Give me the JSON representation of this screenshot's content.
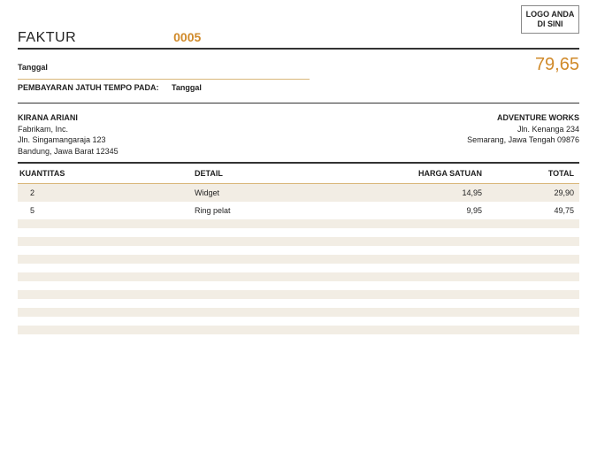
{
  "logo_text": "LOGO ANDA DI SINI",
  "header": {
    "label": "FAKTUR",
    "invoice_number": "0005"
  },
  "date_label": "Tanggal",
  "total_display": "79,65",
  "due": {
    "label": "PEMBAYARAN JATUH TEMPO PADA:",
    "value": "Tanggal"
  },
  "from": {
    "name": "KIRANA ARIANI",
    "company": "Fabrikam, Inc.",
    "street": "Jln. Singamangaraja 123",
    "city": "Bandung, Jawa Barat 12345"
  },
  "to": {
    "name": "ADVENTURE WORKS",
    "street": "Jln. Kenanga 234",
    "city": "Semarang, Jawa Tengah 09876"
  },
  "columns": {
    "qty": "KUANTITAS",
    "detail": "DETAIL",
    "unit": "HARGA SATUAN",
    "total": "TOTAL"
  },
  "items": [
    {
      "qty": "2",
      "detail": "Widget",
      "unit": "14,95",
      "total": "29,90"
    },
    {
      "qty": "5",
      "detail": "Ring pelat",
      "unit": "9,95",
      "total": "49,75"
    },
    {
      "qty": "",
      "detail": "",
      "unit": "",
      "total": ""
    },
    {
      "qty": "",
      "detail": "",
      "unit": "",
      "total": ""
    },
    {
      "qty": "",
      "detail": "",
      "unit": "",
      "total": ""
    },
    {
      "qty": "",
      "detail": "",
      "unit": "",
      "total": ""
    },
    {
      "qty": "",
      "detail": "",
      "unit": "",
      "total": ""
    },
    {
      "qty": "",
      "detail": "",
      "unit": "",
      "total": ""
    },
    {
      "qty": "",
      "detail": "",
      "unit": "",
      "total": ""
    },
    {
      "qty": "",
      "detail": "",
      "unit": "",
      "total": ""
    },
    {
      "qty": "",
      "detail": "",
      "unit": "",
      "total": ""
    },
    {
      "qty": "",
      "detail": "",
      "unit": "",
      "total": ""
    },
    {
      "qty": "",
      "detail": "",
      "unit": "",
      "total": ""
    },
    {
      "qty": "",
      "detail": "",
      "unit": "",
      "total": ""
    },
    {
      "qty": "",
      "detail": "",
      "unit": "",
      "total": ""
    },
    {
      "qty": "",
      "detail": "",
      "unit": "",
      "total": ""
    }
  ]
}
